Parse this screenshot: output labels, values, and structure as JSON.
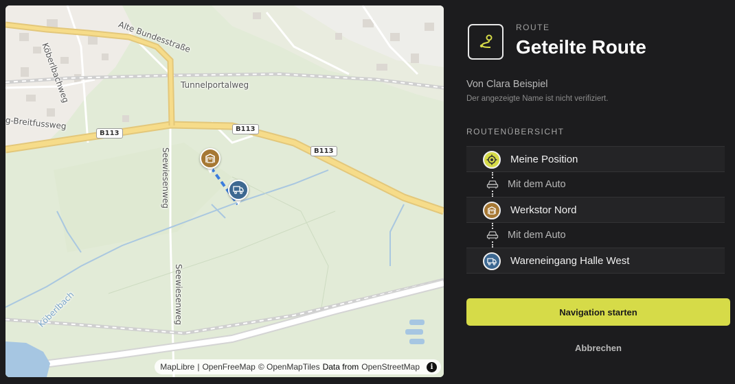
{
  "map": {
    "roads": {
      "alte_bundesstrasse": "Alte Bundesstraße",
      "kobelbachweg": "Köberlbachweg",
      "tunnelportalweg": "Tunnelportalweg",
      "breitfussweg": "g-Breitfussweg",
      "seewiesenweg_1": "Seewiesenweg",
      "seewiesenweg_2": "Seewiesenweg",
      "koberlbach": "Köberlbach"
    },
    "shields": [
      "B113",
      "B113",
      "B113"
    ],
    "attribution": {
      "maplibre": "MapLibre",
      "sep": "|",
      "openfreemap": "OpenFreeMap",
      "openmaptiles": "© OpenMapTiles",
      "data_from": "Data from",
      "osm": "OpenStreetMap",
      "info": "i"
    }
  },
  "panel": {
    "eyebrow": "ROUTE",
    "title": "Geteilte Route",
    "author": "Von Clara Beispiel",
    "author_note": "Der angezeigte Name ist nicht verifiziert.",
    "overview_label": "ROUTENÜBERSICHT",
    "stops": [
      {
        "label": "Meine Position",
        "icon": "target-icon",
        "color": "#d6db48"
      },
      {
        "label": "Werkstor Nord",
        "icon": "gate-icon",
        "color": "#a67834"
      },
      {
        "label": "Wareneingang Halle West",
        "icon": "truck-icon",
        "color": "#3d6891"
      }
    ],
    "legs": [
      {
        "label": "Mit dem Auto",
        "icon": "car-icon"
      },
      {
        "label": "Mit dem Auto",
        "icon": "car-icon"
      }
    ],
    "start_label": "Navigation starten",
    "cancel_label": "Abbrechen"
  },
  "colors": {
    "accent": "#d6db48",
    "background": "#1c1c1e",
    "gate_pin": "#a67834",
    "truck_pin": "#3d6891",
    "route_line": "#3b7ddd"
  }
}
